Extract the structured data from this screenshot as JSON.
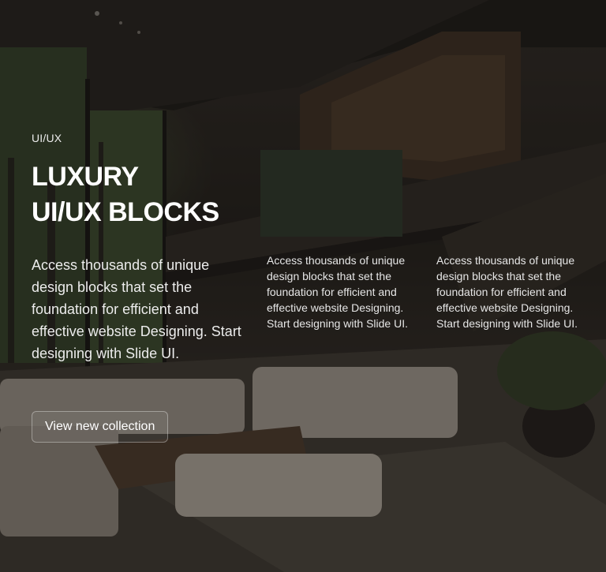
{
  "hero": {
    "eyebrow": "UI/UX",
    "title_line1": "LUXURY",
    "title_line2": "UI/UX BLOCKS",
    "lead": "Access thousands of unique design blocks that set the foundation for efficient and effective website Designing. Start designing with Slide UI.",
    "column_1": "Access thousands of unique design blocks that set the foundation for efficient and effective website Designing. Start designing with Slide UI.",
    "column_2": "Access thousands of unique design blocks that set the foundation for efficient and effective website Designing. Start designing with Slide UI.",
    "cta_label": "View new collection"
  },
  "colors": {
    "overlay": "#0a0908",
    "text": "#ffffff",
    "muted_text": "#ececec"
  }
}
